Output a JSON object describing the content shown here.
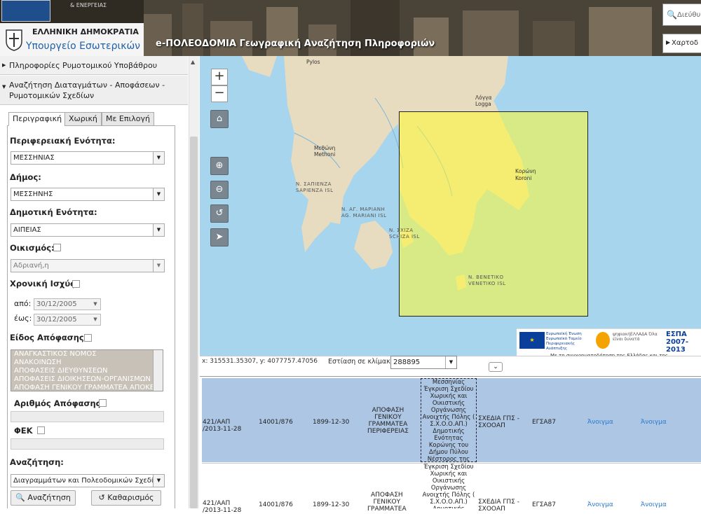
{
  "header": {
    "ministry_sub": "& ΕΝΕΡΓΕΙΑΣ",
    "republic": "ΕΛΛΗΝΙΚΗ ΔΗΜΟΚΡΑΤΙΑ",
    "ministry": "Υπουργείο Εσωτερικών",
    "title": "e-ΠΟΛΕΟΔΟΜΙΑ Γεωγραφική Αναζήτηση Πληροφοριών",
    "search_placeholder": "Διεύθυν",
    "maps_label": "Χαρτοδ"
  },
  "sidebar": {
    "acc1": "Πληροφορίες Ρυμοτομικού Υποβάθρου",
    "acc2_line1": "Αναζήτηση Διαταγμάτων - Αποφάσεων -",
    "acc2_line2": "Ρυμοτομικών Σχεδίων",
    "tabs": [
      "Περιγραφική",
      "Χωρική",
      "Με Επιλογή"
    ],
    "regional_unit_label": "Περιφερειακή Ενότητα:",
    "regional_unit_value": "ΜΕΣΣΗΝΙΑΣ",
    "municipality_label": "Δήμος:",
    "municipality_value": "ΜΕΣΣΗΝΗΣ",
    "municipal_unit_label": "Δημοτική Ενότητα:",
    "municipal_unit_value": "ΑΙΠΕΙΑΣ",
    "settlement_label": "Οικισμός:",
    "settlement_value": "Αδριανή,η",
    "validity_label": "Χρονική Ισχύς",
    "from_label": "από:",
    "from_value": "30/12/2005",
    "to_label": "έως:",
    "to_value": "30/12/2005",
    "decision_type_label": "Είδος Απόφασης:",
    "decision_types": [
      "ΑΝΑΓΚΑΣΤΙΚΟΣ ΝΟΜΟΣ",
      "ΑΝΑΚΟΙΝΩΣΗ",
      "ΑΠΟΦΑΣΕΙΣ ΔΙΕΥΘΥΝΣΕΩΝ",
      "ΑΠΟΦΑΣΕΙΣ ΔΙΟΙΚΗΣΕΩΝ-ΟΡΓΑΝΙΣΜΩΝ",
      "ΑΠΟΦΑΣΗ ΓΕΝΙΚΟΥ ΓΡΑΜΜΑΤΕΑ ΑΠΟΚΕ"
    ],
    "decision_number_label": "Αριθμός Απόφασης:",
    "fek_label": "ΦΕΚ",
    "search_label": "Αναζήτηση:",
    "search_value": "Διαγραμμάτων και Πολεοδομικών Σχεδίων",
    "search_button": "Αναζήτηση",
    "clear_button": "Καθαρισμός"
  },
  "map": {
    "labels": {
      "pylos": "Pylos",
      "methoni": "Μεθώνη\nMethoni",
      "sapienza": "Ν. ΣΑΠΙΕΝΖΑ\nSAPIENZA ISL",
      "mariani": "Ν. ΑΓ. ΜΑΡΙΑΝΗ\nAG. MARIANI ISL",
      "schiza": "Ν. ΣΧΙΖΑ\nSCHIZA ISL",
      "koroni": "Κορώνη\nKoroni",
      "venetiko": "Ν. ΒΕΝΕΤΙΚΟ\nVENETIKO ISL",
      "logga": "Λόγγα\nLogga"
    },
    "logos": {
      "eu_text": "Ευρωπαϊκή Ένωση Ευρωπαϊκό Ταμείο Περιφερειακής Ανάπτυξης",
      "digital_text": "ψηφιακήΕΛΛΑΔΑ Όλα είναι δυνατά",
      "espa": "ΕΣΠΑ 2007-2013",
      "caption": "Με τη συγχρηματοδότηση της Ελλάδας και της"
    }
  },
  "statusbar": {
    "coords": "x: 315531.35307, y: 4077757.47056",
    "scale_label": "Εστίαση σε κλίμακα:",
    "scale_value": "288895"
  },
  "grid": {
    "rows": [
      {
        "c1": "421/ΑΑΠ\n/2013-11-28",
        "c2": "14001/876",
        "c3": "1899-12-30",
        "c4": "ΑΠΟΦΑΣΗ\nΓΕΝΙΚΟΥ\nΓΡΑΜΜΑΤΕΑ\nΠΕΡΙΦΕΡΕΙΑΣ",
        "desc": "Μεσσηνίας\nΈγκριση Σχεδίου\nΧωρικής και\nΟικιστικής\nΟργάνωσης\nΑνοιχτής Πόλης (\nΣ.Χ.Ο.Ο.ΑΠ.)\nΔημοτικής\nΕνότητας\nΚορώνης του\nΔήμου Πύλου\nΝέστορος της\nΠεριφερειακής\nΕνότητας\nΜεσσηνίας",
        "c6": "ΣΧΕΔΙΑ ΓΠΣ -\nΣΧΟΟΑΠ",
        "c7": "ΕΓΣΑ87",
        "c8": "Άνοιγμα",
        "c9": "Άνοιγμα"
      },
      {
        "c1": "421/ΑΑΠ\n/2013-11-28",
        "c2": "14001/876",
        "c3": "1899-12-30",
        "c4": "ΑΠΟΦΑΣΗ\nΓΕΝΙΚΟΥ\nΓΡΑΜΜΑΤΕΑ",
        "desc": "Έγκριση Σχεδίου\nΧωρικής και\nΟικιστικής\nΟργάνωσης\nΑνοιχτής Πόλης (\nΣ.Χ.Ο.Ο.ΑΠ.)\nΔημοτικής\nΕνότητας",
        "c6": "ΣΧΕΔΙΑ ΓΠΣ -\nΣΧΟΟΑΠ",
        "c7": "ΕΓΣΑ87",
        "c8": "Άνοιγμα",
        "c9": "Άνοιγμα"
      }
    ]
  },
  "colors": {
    "accent": "#2060a8",
    "sea": "#a6d5ed",
    "land": "#e8dcc0",
    "selection": "#fffc32",
    "row_selected": "#adc6e3",
    "link": "#2a7ad0"
  }
}
